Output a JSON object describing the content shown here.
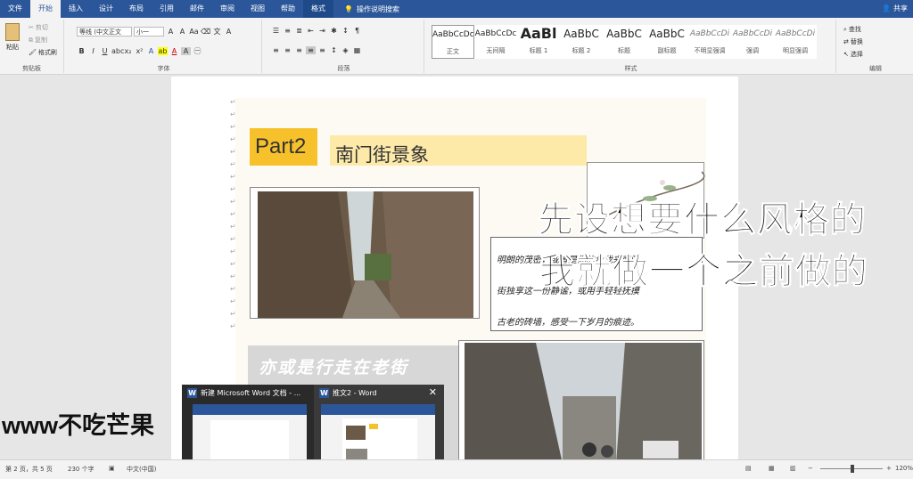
{
  "tabs": [
    "文件",
    "开始",
    "插入",
    "设计",
    "布局",
    "引用",
    "邮件",
    "审阅",
    "视图",
    "帮助",
    "格式"
  ],
  "active_tab": 1,
  "tell_me": "操作说明搜索",
  "share": "共享",
  "ribbon": {
    "clipboard": {
      "paste": "粘贴",
      "cut": "剪切",
      "copy": "复制",
      "format_painter": "格式刷",
      "label": "剪贴板"
    },
    "font": {
      "name": "等线 (中文正文",
      "size": "小一",
      "label": "字体"
    },
    "paragraph": {
      "label": "段落"
    },
    "styles": {
      "label": "样式",
      "items": [
        {
          "sample": "AaBbCcDc",
          "name": "正文"
        },
        {
          "sample": "AaBbCcDc",
          "name": "无间隔"
        },
        {
          "sample": "AaBl",
          "name": "标题 1"
        },
        {
          "sample": "AaBbC",
          "name": "标题 2"
        },
        {
          "sample": "AaBbC",
          "name": "标题"
        },
        {
          "sample": "AaBbC",
          "name": "副标题"
        },
        {
          "sample": "AaBbCcDi",
          "name": "不明显强调"
        },
        {
          "sample": "AaBbCcDi",
          "name": "强调"
        },
        {
          "sample": "AaBbCcDi",
          "name": "明显强调"
        }
      ]
    },
    "editing": {
      "find": "查找",
      "replace": "替换",
      "select": "选择",
      "label": "编辑"
    }
  },
  "document": {
    "part_label": "Part2",
    "part_title": "南门街景象",
    "text_lines": [
      "明朗的茂密，或者是你的步伐来南门",
      "街独享这一份静谧，或用手轻轻抚摸",
      "古老的砖墙，感受一下岁月的痕迹。"
    ],
    "poem": "亦或是行走在老街"
  },
  "overlay": {
    "line1": "先设想要什么风格的",
    "line2": "我就做一个之前做的",
    "watermark": "www不吃芒果"
  },
  "taskbar": {
    "thumb1_title": "新建 Microsoft Word 文档 - ...",
    "thumb2_title": "推文2 - Word",
    "close": "✕"
  },
  "status": {
    "page": "第 2 页，共 5 页",
    "words": "230 个字",
    "lang": "中文(中国)",
    "zoom": "120%"
  }
}
